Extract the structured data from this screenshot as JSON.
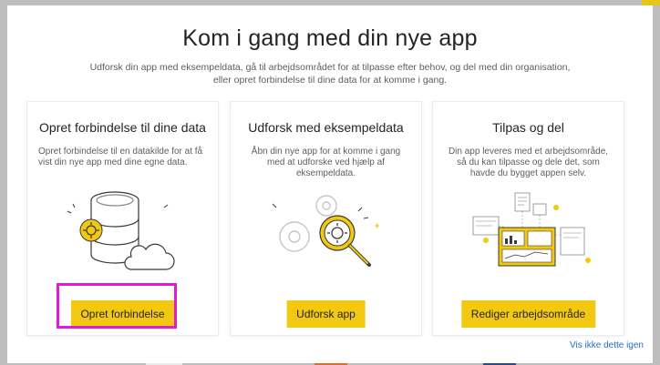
{
  "dialog": {
    "title": "Kom i gang med din nye app",
    "subtitle_line1": "Udforsk din app med eksempeldata, gå til arbejdsområdet for at tilpasse efter behov, og del med din organisation,",
    "subtitle_line2": "eller opret forbindelse til dine data for at komme i gang.",
    "dont_show_again": "Vis ikke dette igen"
  },
  "cards": [
    {
      "title": "Opret forbindelse til dine data",
      "description": "Opret forbindelse til en datakilde for at få vist din nye app med dine egne data.",
      "button": "Opret forbindelse",
      "icon": "database-cloud-icon"
    },
    {
      "title": "Udforsk med eksempeldata",
      "description": "Åbn din nye app for at komme i gang med at udforske ved hjælp af eksempeldata.",
      "button": "Udforsk app",
      "icon": "gears-magnifier-icon"
    },
    {
      "title": "Tilpas og del",
      "description": "Din app leveres med et arbejdsområde, så du kan tilpasse og dele det, som havde du bygget appen selv.",
      "button": "Rediger arbejdsområde",
      "icon": "dashboard-icon"
    }
  ],
  "colors": {
    "accent": "#f2c811",
    "highlight": "#e01dd5",
    "link": "#2b6fbf"
  }
}
